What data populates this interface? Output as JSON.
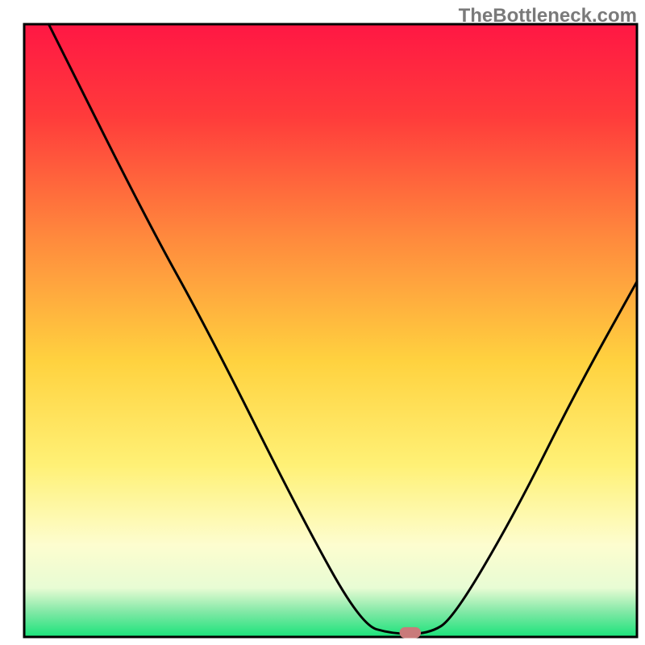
{
  "watermark": "TheBottleneck.com",
  "chart_data": {
    "type": "line",
    "title": "",
    "xlabel": "",
    "ylabel": "",
    "xlim": [
      0,
      100
    ],
    "ylim": [
      0,
      100
    ],
    "axes_visible": false,
    "frame_visible": true,
    "background": {
      "type": "vertical-gradient",
      "stops": [
        {
          "offset": 0.0,
          "color": "#ff1744"
        },
        {
          "offset": 0.15,
          "color": "#ff3b3b"
        },
        {
          "offset": 0.35,
          "color": "#ff8a3d"
        },
        {
          "offset": 0.55,
          "color": "#ffd23f"
        },
        {
          "offset": 0.72,
          "color": "#fff176"
        },
        {
          "offset": 0.85,
          "color": "#fdfdcf"
        },
        {
          "offset": 0.92,
          "color": "#e8fcd4"
        },
        {
          "offset": 0.96,
          "color": "#7fe8a5"
        },
        {
          "offset": 1.0,
          "color": "#19e37a"
        }
      ]
    },
    "curve": {
      "description": "V-shaped bottleneck curve with a slight kink on the left descent",
      "color": "#000000",
      "width": 3,
      "points_xy": [
        [
          4,
          100
        ],
        [
          20,
          68
        ],
        [
          30,
          50
        ],
        [
          45,
          20
        ],
        [
          55,
          2
        ],
        [
          60,
          0.5
        ],
        [
          66,
          0.5
        ],
        [
          70,
          3
        ],
        [
          80,
          20
        ],
        [
          90,
          40
        ],
        [
          100,
          58
        ]
      ]
    },
    "marker": {
      "shape": "rounded-rect",
      "color": "#c97a7a",
      "x": 63,
      "y": 0.7,
      "width_frac": 0.035,
      "height_frac": 0.018
    }
  }
}
